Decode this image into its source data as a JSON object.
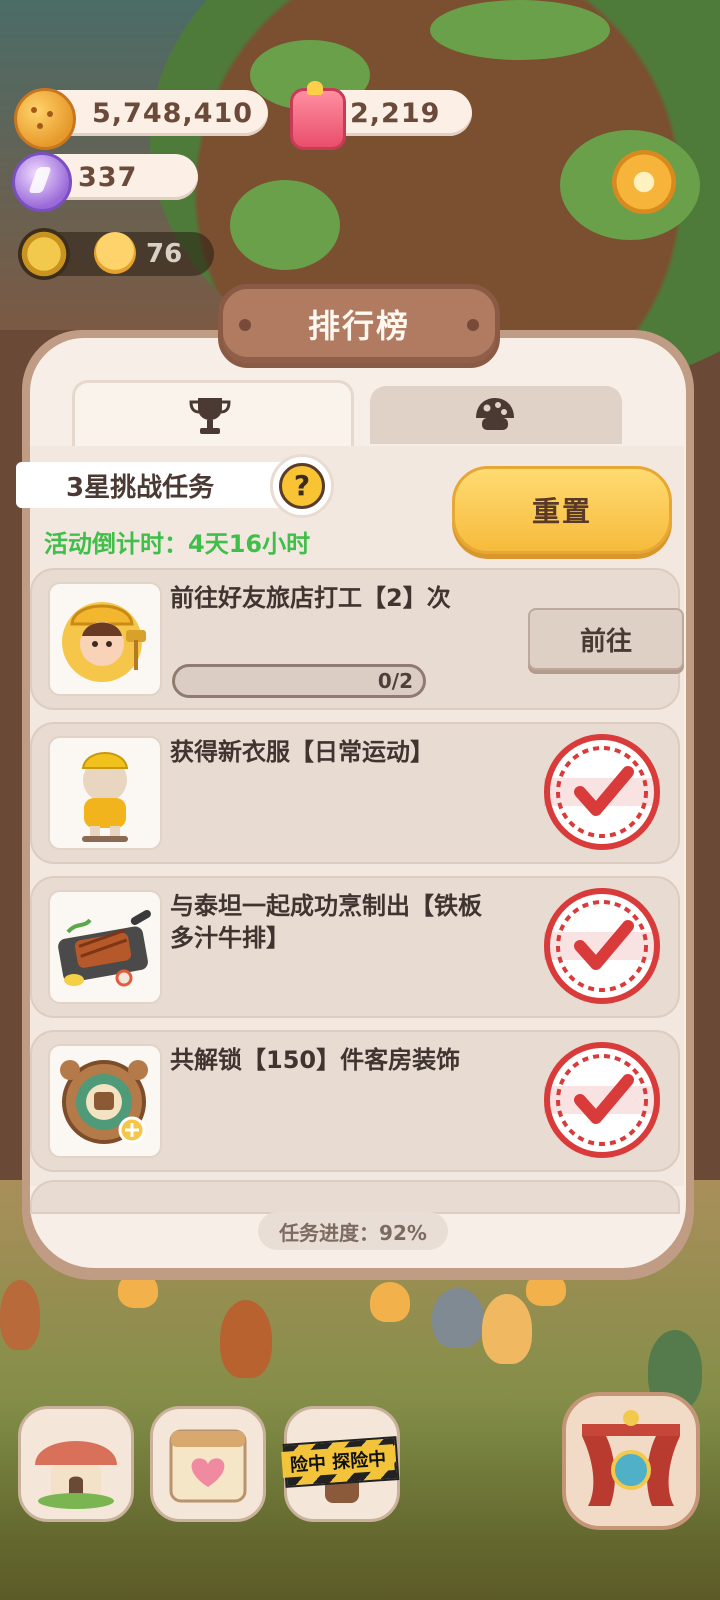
{
  "hud": {
    "cookies": "5,748,410",
    "candy": "2,219",
    "gems": "337",
    "energy": "76"
  },
  "modal": {
    "title": "排行榜",
    "tabs": [
      {
        "icon": "trophy-icon",
        "active": true
      },
      {
        "icon": "cookie-icon",
        "active": false
      }
    ],
    "section_label": "3星挑战任务",
    "help_label": "?",
    "countdown": "活动倒计时：4天16小时",
    "reset_label": "重置",
    "tasks": [
      {
        "title": "前往好友旅店打工【2】次",
        "progress_text": "0/2",
        "progress": 0,
        "action_label": "前往",
        "completed": false
      },
      {
        "title": "获得新衣服【日常运动】",
        "completed": true
      },
      {
        "title": "与泰坦一起成功烹制出【铁板多汁牛排】",
        "completed": true
      },
      {
        "title": "共解锁【150】件客房装饰",
        "completed": true
      }
    ],
    "footer_progress": "任务进度：92%"
  },
  "bottom_nav": {
    "explore_caution": "险中 探险中"
  },
  "colors": {
    "accent_yellow": "#f6bb3c",
    "countdown_green": "#3fbf4a",
    "stamp_red": "#d93b3b"
  }
}
